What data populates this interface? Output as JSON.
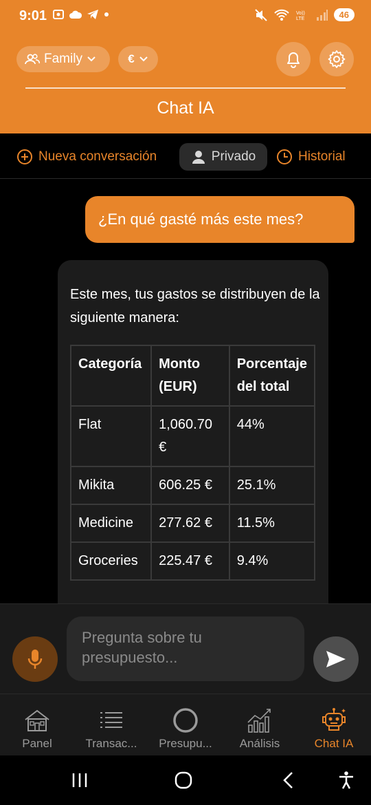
{
  "status_bar": {
    "time": "9:01",
    "battery": "46"
  },
  "header": {
    "group_label": "Family",
    "currency_label": "€",
    "title": "Chat IA"
  },
  "toolbar": {
    "new_conversation": "Nueva conversación",
    "private": "Privado",
    "history": "Historial"
  },
  "chat": {
    "user_message": "¿En qué gasté más este mes?",
    "ai_intro": "Este mes, tus gastos se distribuyen de la siguiente manera:",
    "table": {
      "headers": [
        "Categoría",
        "Monto (EUR)",
        "Porcentaje del total"
      ],
      "rows": [
        [
          "Flat",
          "1,060.70 €",
          "44%"
        ],
        [
          "Mikita",
          "606.25 €",
          "25.1%"
        ],
        [
          "Medicine",
          "277.62 €",
          "11.5%"
        ],
        [
          "Groceries",
          "225.47 €",
          "9.4%"
        ]
      ]
    }
  },
  "input": {
    "placeholder": "Pregunta sobre tu presupuesto..."
  },
  "nav": {
    "items": [
      {
        "label": "Panel",
        "icon": "house-icon"
      },
      {
        "label": "Transac...",
        "icon": "list-icon"
      },
      {
        "label": "Presupu...",
        "icon": "ring-icon"
      },
      {
        "label": "Análisis",
        "icon": "chart-icon"
      },
      {
        "label": "Chat IA",
        "icon": "robot-icon"
      }
    ]
  },
  "colors": {
    "accent": "#e8852a",
    "background": "#000000",
    "bubble": "#1c1c1c"
  }
}
